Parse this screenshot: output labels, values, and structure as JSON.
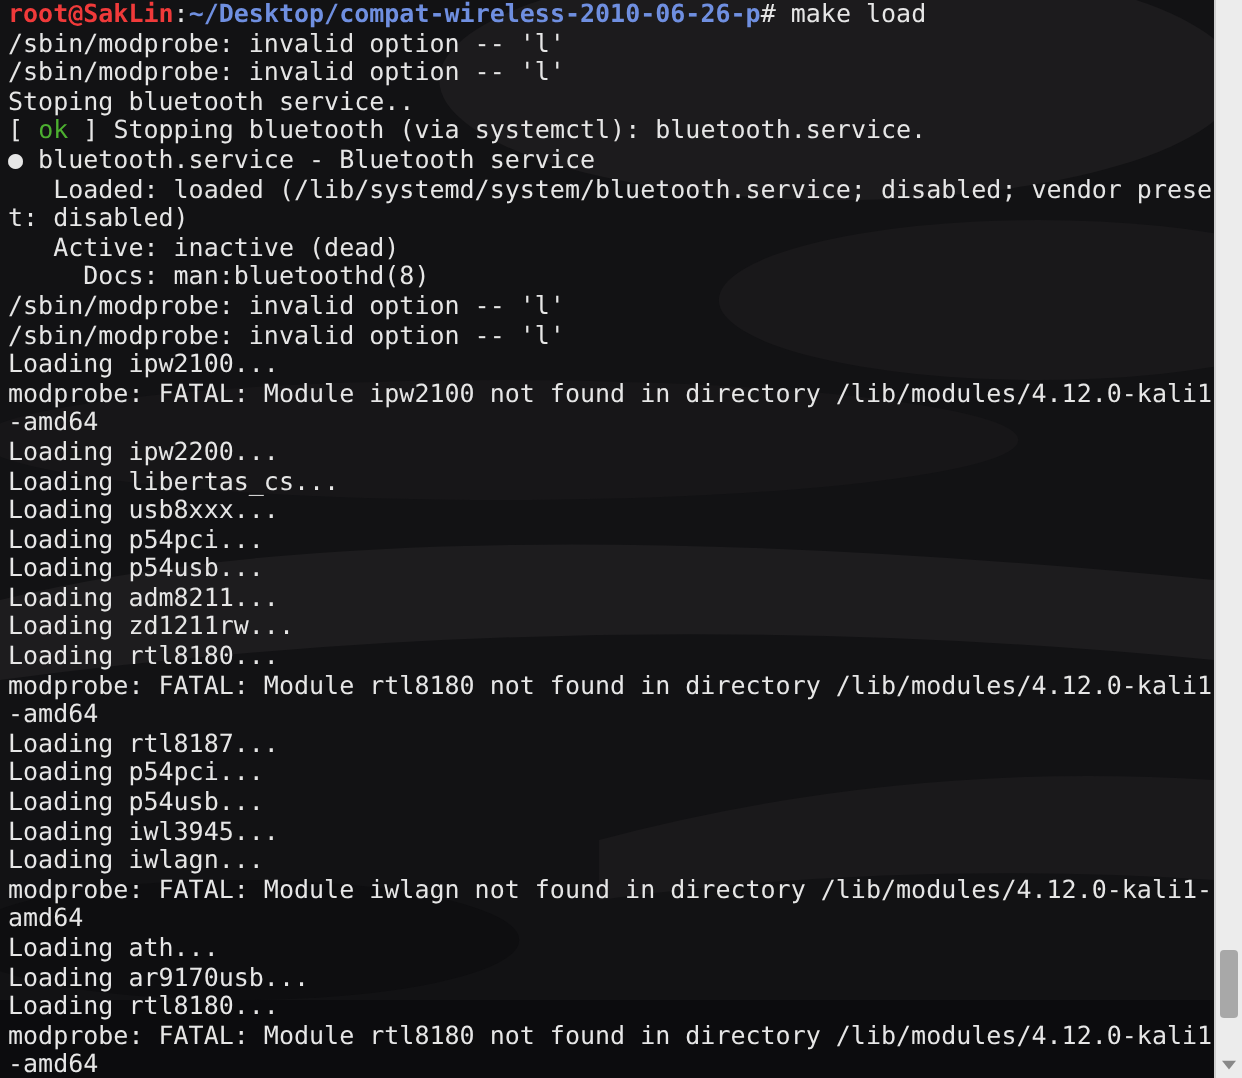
{
  "terminal": {
    "lines": [
      [
        {
          "kind": "user",
          "text": "root@SakLin"
        },
        {
          "kind": "plain",
          "text": ":"
        },
        {
          "kind": "path",
          "text": "~/Desktop/compat-wireless-2010-06-26-p"
        },
        {
          "kind": "plain",
          "text": "# make load"
        }
      ],
      [
        {
          "kind": "plain",
          "text": "/sbin/modprobe: invalid option -- 'l'"
        }
      ],
      [
        {
          "kind": "plain",
          "text": "/sbin/modprobe: invalid option -- 'l'"
        }
      ],
      [
        {
          "kind": "plain",
          "text": "Stoping bluetooth service.."
        }
      ],
      [
        {
          "kind": "plain",
          "text": "[ "
        },
        {
          "kind": "ok",
          "text": "ok"
        },
        {
          "kind": "plain",
          "text": " ] Stopping bluetooth (via systemctl): bluetooth.service."
        }
      ],
      [
        {
          "kind": "plain",
          "text": "● bluetooth.service - Bluetooth service"
        }
      ],
      [
        {
          "kind": "plain",
          "text": "   Loaded: loaded (/lib/systemd/system/bluetooth.service; disabled; vendor prese"
        }
      ],
      [
        {
          "kind": "plain",
          "text": "t: disabled)"
        }
      ],
      [
        {
          "kind": "plain",
          "text": "   Active: inactive (dead)"
        }
      ],
      [
        {
          "kind": "plain",
          "text": "     Docs: man:bluetoothd(8)"
        }
      ],
      [
        {
          "kind": "plain",
          "text": "/sbin/modprobe: invalid option -- 'l'"
        }
      ],
      [
        {
          "kind": "plain",
          "text": "/sbin/modprobe: invalid option -- 'l'"
        }
      ],
      [
        {
          "kind": "plain",
          "text": "Loading ipw2100..."
        }
      ],
      [
        {
          "kind": "plain",
          "text": "modprobe: FATAL: Module ipw2100 not found in directory /lib/modules/4.12.0-kali1"
        }
      ],
      [
        {
          "kind": "plain",
          "text": "-amd64"
        }
      ],
      [
        {
          "kind": "plain",
          "text": "Loading ipw2200..."
        }
      ],
      [
        {
          "kind": "plain",
          "text": "Loading libertas_cs..."
        }
      ],
      [
        {
          "kind": "plain",
          "text": "Loading usb8xxx..."
        }
      ],
      [
        {
          "kind": "plain",
          "text": "Loading p54pci..."
        }
      ],
      [
        {
          "kind": "plain",
          "text": "Loading p54usb..."
        }
      ],
      [
        {
          "kind": "plain",
          "text": "Loading adm8211..."
        }
      ],
      [
        {
          "kind": "plain",
          "text": "Loading zd1211rw..."
        }
      ],
      [
        {
          "kind": "plain",
          "text": "Loading rtl8180..."
        }
      ],
      [
        {
          "kind": "plain",
          "text": "modprobe: FATAL: Module rtl8180 not found in directory /lib/modules/4.12.0-kali1"
        }
      ],
      [
        {
          "kind": "plain",
          "text": "-amd64"
        }
      ],
      [
        {
          "kind": "plain",
          "text": "Loading rtl8187..."
        }
      ],
      [
        {
          "kind": "plain",
          "text": "Loading p54pci..."
        }
      ],
      [
        {
          "kind": "plain",
          "text": "Loading p54usb..."
        }
      ],
      [
        {
          "kind": "plain",
          "text": "Loading iwl3945..."
        }
      ],
      [
        {
          "kind": "plain",
          "text": "Loading iwlagn..."
        }
      ],
      [
        {
          "kind": "plain",
          "text": "modprobe: FATAL: Module iwlagn not found in directory /lib/modules/4.12.0-kali1-"
        }
      ],
      [
        {
          "kind": "plain",
          "text": "amd64"
        }
      ],
      [
        {
          "kind": "plain",
          "text": "Loading ath..."
        }
      ],
      [
        {
          "kind": "plain",
          "text": "Loading ar9170usb..."
        }
      ],
      [
        {
          "kind": "plain",
          "text": "Loading rtl8180..."
        }
      ],
      [
        {
          "kind": "plain",
          "text": "modprobe: FATAL: Module rtl8180 not found in directory /lib/modules/4.12.0-kali1"
        }
      ],
      [
        {
          "kind": "plain",
          "text": "-amd64"
        }
      ]
    ]
  }
}
